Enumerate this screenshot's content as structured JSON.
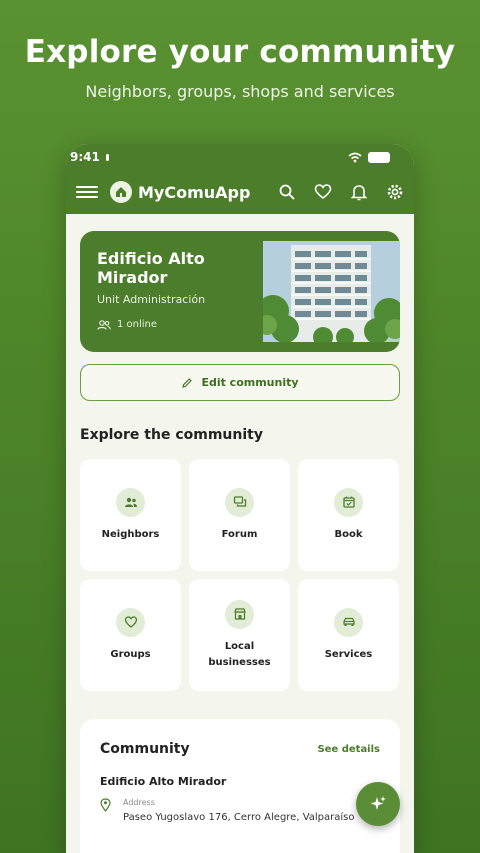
{
  "header": {
    "title": "Explore your community",
    "subtitle": "Neighbors, groups, shops and services"
  },
  "status_bar": {
    "time": "9:41"
  },
  "app_bar": {
    "title": "MyComuApp",
    "icons": [
      "menu-icon",
      "search-icon",
      "heart-icon",
      "bell-icon",
      "gear-icon"
    ]
  },
  "hero": {
    "title": "Edificio Alto Mirador",
    "subtitle": "Unit Administración",
    "online": "1 online"
  },
  "edit_button": {
    "label": "Edit community"
  },
  "explore": {
    "title": "Explore the community",
    "tiles": [
      {
        "label": "Neighbors",
        "icon": "people-icon"
      },
      {
        "label": "Forum",
        "icon": "chat-icon"
      },
      {
        "label": "Book",
        "icon": "calendar-check-icon"
      },
      {
        "label": "Groups",
        "icon": "heart-icon"
      },
      {
        "label": "Local businesses",
        "icon": "store-icon"
      },
      {
        "label": "Services",
        "icon": "car-icon"
      }
    ]
  },
  "community": {
    "title": "Community",
    "link": "See details",
    "name": "Edificio Alto Mirador",
    "address_label": "Address",
    "address": "Paseo Yugoslavo 176, Cerro Alegre, Valparaíso"
  },
  "colors": {
    "brand": "#4b7d2a",
    "background": "#4e8429",
    "surface": "#f4f5ec"
  }
}
